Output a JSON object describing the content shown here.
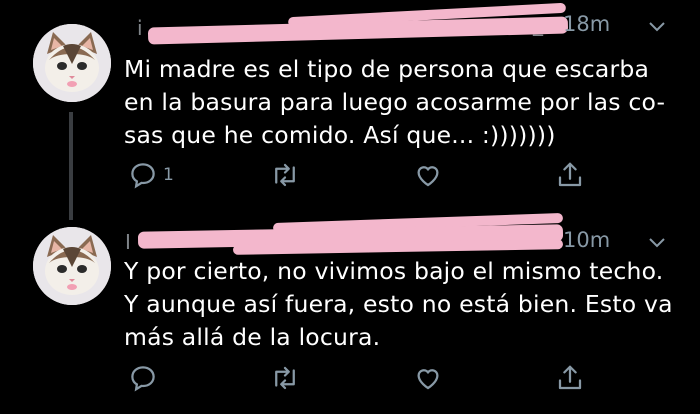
{
  "colors": {
    "background": "#000000",
    "text": "#ffffff",
    "muted": "#8899a6",
    "redaction": "#f3b7cc",
    "thread_line": "#3a3d41"
  },
  "tweets": [
    {
      "avatar_icon": "cat-avatar-icon",
      "username_partial": "i",
      "handle_partial": "_",
      "time": "18m",
      "text": "Mi madre es el tipo de persona que escarba en la basura para luego acosarme por las co-sas que he comido. Así que... :)))))))",
      "lines": [
        "Mi madre es el tipo de persona que escarba",
        "en la basura para luego acosarme por las co-",
        "sas que he comido. Así que... :)))))))"
      ],
      "reply_count": "1",
      "actions": [
        "reply-icon",
        "retweet-icon",
        "like-icon",
        "share-icon"
      ]
    },
    {
      "avatar_icon": "cat-avatar-icon",
      "username_partial": "I",
      "handle_partial": "",
      "time": "10m",
      "text": "Y por cierto, no vivimos bajo el mismo techo. Y aunque así fuera, esto no está bien. Esto va más allá de la locura.",
      "lines": [
        "Y por cierto, no vivimos bajo el mismo techo.",
        "Y aunque así fuera, esto no está bien. Esto va",
        "más allá de la locura."
      ],
      "reply_count": "",
      "actions": [
        "reply-icon",
        "retweet-icon",
        "like-icon",
        "share-icon"
      ]
    }
  ]
}
